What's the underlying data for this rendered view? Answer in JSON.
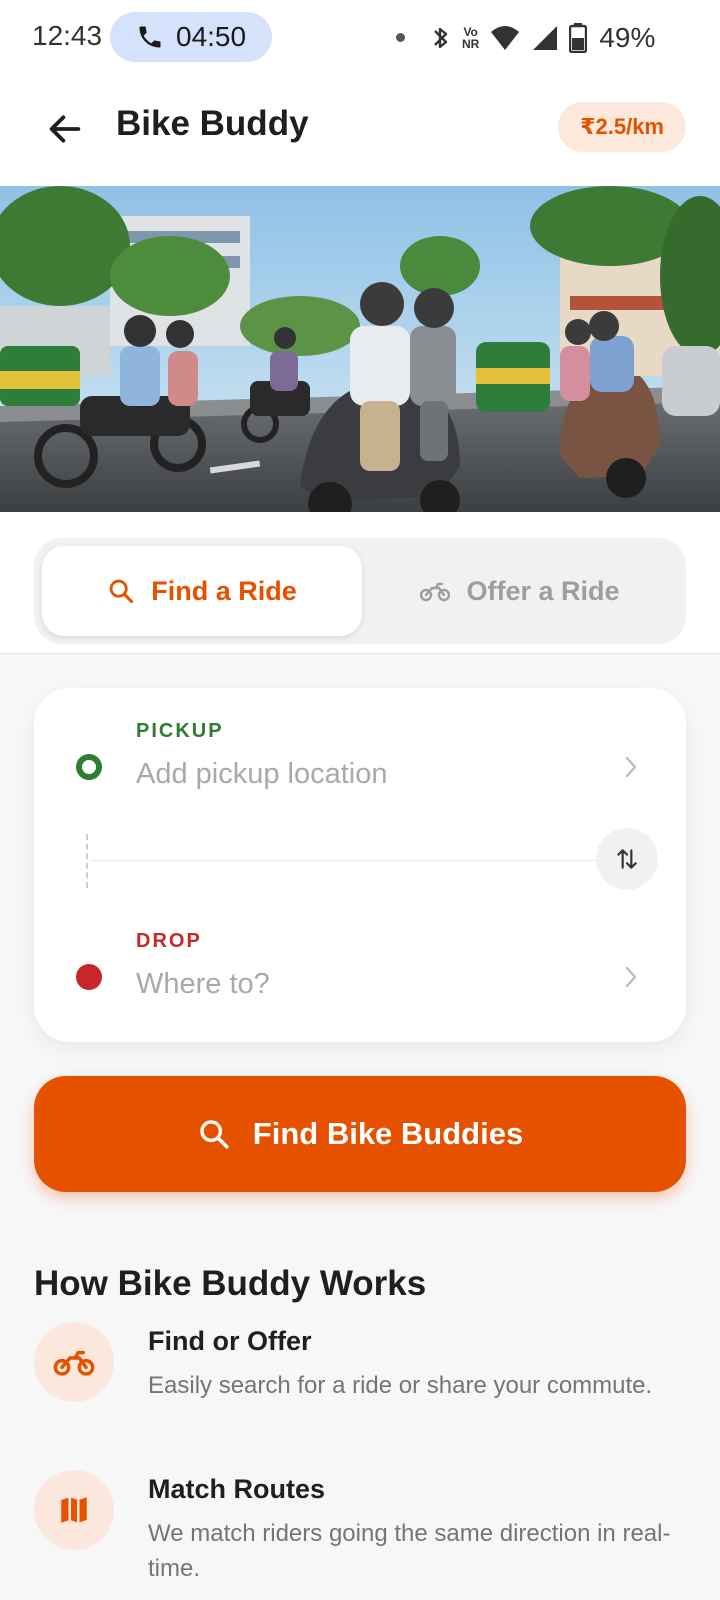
{
  "status_bar": {
    "time": "12:43",
    "call_timer": "04:50",
    "volte_line1": "Vo",
    "volte_line2": "NR",
    "battery": "49%"
  },
  "header": {
    "title": "Bike Buddy",
    "rate": "₹2.5/km"
  },
  "tabs": [
    {
      "label": "Find a Ride",
      "selected": true
    },
    {
      "label": "Offer a Ride",
      "selected": false
    }
  ],
  "location": {
    "pickup_label": "PICKUP",
    "pickup_placeholder": "Add pickup location",
    "drop_label": "DROP",
    "drop_placeholder": "Where to?"
  },
  "cta": {
    "label": "Find Bike Buddies"
  },
  "how_it_works": {
    "title": "How Bike Buddy Works",
    "steps": [
      {
        "icon": "motorbike-icon",
        "title": "Find or Offer",
        "desc": "Easily search for a ride or share your commute."
      },
      {
        "icon": "map-icon",
        "title": "Match Routes",
        "desc": "We match riders going the same direction in real-time."
      }
    ]
  },
  "colors": {
    "accent": "#e65100",
    "accent_soft": "#fde9dc",
    "pickup_green": "#2e7d32",
    "drop_red": "#c62828"
  }
}
